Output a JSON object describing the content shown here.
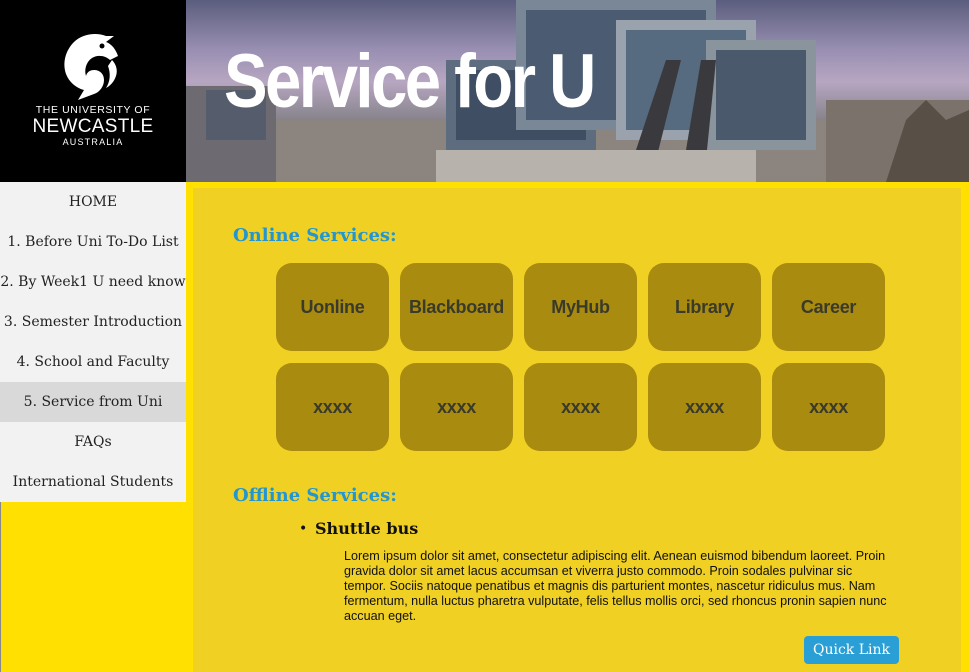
{
  "logo": {
    "line1": "THE UNIVERSITY OF",
    "line2": "NEWCASTLE",
    "line3": "AUSTRALIA"
  },
  "banner": {
    "title": "Service for U"
  },
  "nav": {
    "items": [
      {
        "label": "HOME"
      },
      {
        "label": "1. Before Uni To-Do List"
      },
      {
        "label": "2. By Week1 U need know"
      },
      {
        "label": "3. Semester Introduction"
      },
      {
        "label": "4. School and Faculty"
      },
      {
        "label": "5. Service from Uni"
      },
      {
        "label": "FAQs"
      },
      {
        "label": "International Students"
      }
    ],
    "active_label": "5. Service from Uni"
  },
  "online": {
    "title": "Online Services:",
    "tiles": [
      {
        "label": "Uonline"
      },
      {
        "label": "Blackboard"
      },
      {
        "label": "MyHub"
      },
      {
        "label": "Library"
      },
      {
        "label": "Career"
      },
      {
        "label": "xxxx"
      },
      {
        "label": "xxxx"
      },
      {
        "label": "xxxx"
      },
      {
        "label": "xxxx"
      },
      {
        "label": "xxxx"
      }
    ]
  },
  "offline": {
    "title": "Offline Services:",
    "item_title": "Shuttle bus",
    "item_text": "Lorem ipsum dolor sit amet, consectetur adipiscing elit. Aenean euismod bibendum laoreet. Proin gravida dolor sit amet lacus accumsan et viverra justo commodo. Proin sodales pulvinar sic tempor. Sociis natoque penatibus et magnis dis parturient montes, nascetur ridiculus mus. Nam fermentum, nulla luctus pharetra vulputate, felis tellus mollis orci, sed rhoncus pronin sapien nunc accuan eget.",
    "quick_link_label": "Quick Link"
  },
  "colors": {
    "page_bg": "#ffe000",
    "panel_bg": "#f1d024",
    "tile_bg": "#a98b10",
    "heading": "#2496cf",
    "button": "#2a9fd6"
  }
}
